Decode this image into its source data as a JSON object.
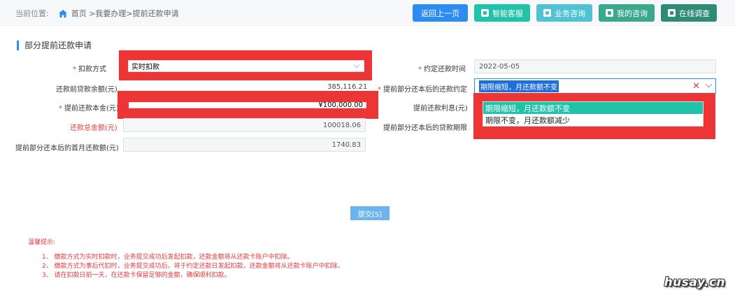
{
  "breadcrumb": {
    "label": "当前位置:",
    "path": "首页 >我要办理>提前还款申请"
  },
  "header_buttons": {
    "back": "返回上一页",
    "smart_service": "智能客服",
    "consult": "业务咨询",
    "my_consult": "我的咨询",
    "survey": "在线调查"
  },
  "section_title": "部分提前还款申请",
  "form": {
    "deduct_method_label": "扣款方式",
    "deduct_method_value": "实时扣款",
    "agreed_date_label": "约定还款时间",
    "agreed_date_value": "2022-05-05",
    "balance_before_label": "还款前贷款余额(元)",
    "balance_before_value": "385,116.21",
    "repay_agreement_label": "提前部分还本后的还款约定",
    "repay_agreement_value": "期限缩短，月还款额不变",
    "principal_label": "提前还款本金(元)",
    "principal_value": "¥100,000.00",
    "interest_label": "提前还款利息(元)",
    "total_label": "还款总金额(元)",
    "total_value": "100018.06",
    "term_label": "提前部分还本后的贷款期限",
    "monthly_label": "提前部分还本后的首月还款额(元)",
    "monthly_value": "1740.83"
  },
  "dropdown_options": [
    "期限缩短，月还款额不变",
    "期限不变，月还款额减少"
  ],
  "submit_label": "提交[S]",
  "tips": {
    "title": "温馨提示:",
    "items": [
      "1、 缴款方式为实时扣款时，业务提交成功后发起扣款，还款金额将从还款卡账户中扣除。",
      "2、 缴款方式为事后代扣时，业务提交成功后，将于约定还款日发起扣款，还款金额将从还款卡账户中扣除。",
      "3、 请在扣款日前一天，在还款卡保留足够的金额，确保顺利扣款。"
    ]
  },
  "watermark": "husay.cn",
  "colors": {
    "primary": "#2d8cf0",
    "teal": "#20c3a8",
    "red": "#ee3535"
  }
}
